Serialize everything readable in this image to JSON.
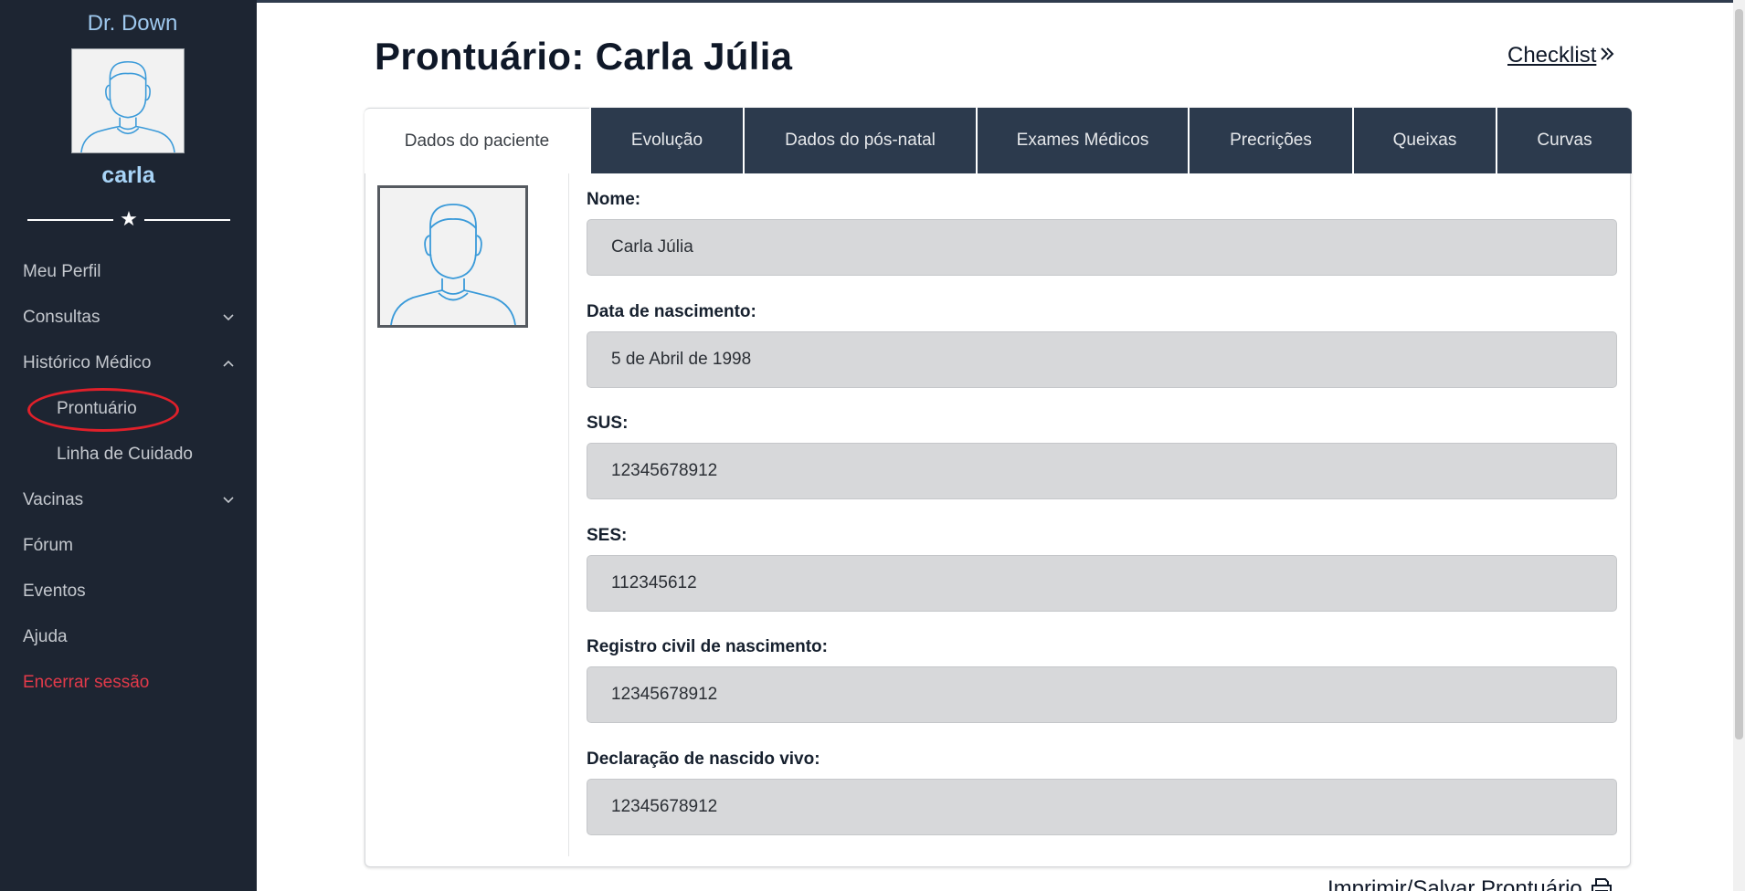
{
  "sidebar": {
    "brand": "Dr. Down",
    "username": "carla",
    "divider_icon": "star-icon",
    "nav": [
      {
        "label": "Meu Perfil"
      },
      {
        "label": "Consultas",
        "icon": "chevron-down-icon"
      },
      {
        "label": "Histórico Médico",
        "icon": "chevron-up-icon"
      },
      {
        "label": "Prontuário"
      },
      {
        "label": "Linha de Cuidado"
      },
      {
        "label": "Vacinas",
        "icon": "chevron-down-icon"
      },
      {
        "label": "Fórum"
      },
      {
        "label": "Eventos"
      },
      {
        "label": "Ajuda"
      },
      {
        "label": "Encerrar sessão"
      }
    ]
  },
  "header": {
    "title": "Prontuário: Carla Júlia",
    "checklist_label": "Checklist"
  },
  "tabs": [
    {
      "label": "Dados do paciente"
    },
    {
      "label": "Evolução"
    },
    {
      "label": "Dados do pós-natal"
    },
    {
      "label": "Exames Médicos"
    },
    {
      "label": "Precrições"
    },
    {
      "label": "Queixas"
    },
    {
      "label": "Curvas"
    }
  ],
  "fields": [
    {
      "label": "Nome:",
      "value": "Carla Júlia"
    },
    {
      "label": "Data de nascimento:",
      "value": "5 de Abril de 1998"
    },
    {
      "label": "SUS:",
      "value": "12345678912"
    },
    {
      "label": "SES:",
      "value": "112345612"
    },
    {
      "label": "Registro civil de nascimento:",
      "value": "12345678912"
    },
    {
      "label": "Declaração de nascido vivo:",
      "value": "12345678912"
    }
  ],
  "footer": {
    "print_label": "Imprimir/Salvar Prontuário"
  },
  "colors": {
    "sidebar_bg": "#1d2532",
    "tab_bg": "#2c3a4d",
    "brand": "#9fc9ef",
    "logout": "#e23a4a",
    "highlight": "#e0202a",
    "avatar_stroke": "#3a9ad9"
  }
}
